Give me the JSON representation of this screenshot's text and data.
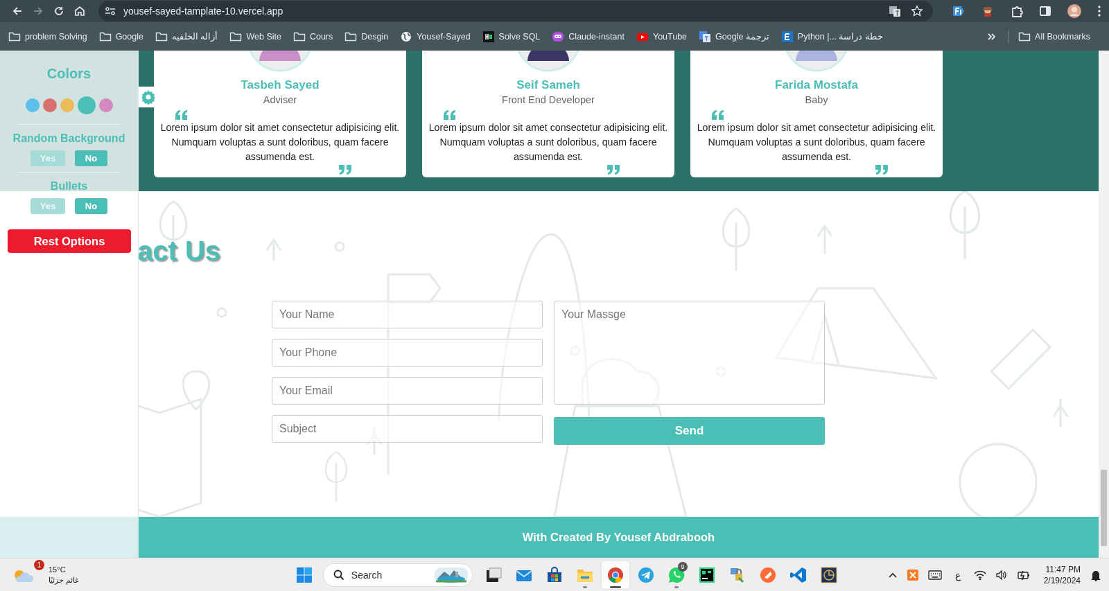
{
  "browser": {
    "nav": [
      {
        "kind": "back",
        "disabled": false
      },
      {
        "kind": "forward",
        "disabled": true
      },
      {
        "kind": "reload",
        "disabled": false
      },
      {
        "kind": "home",
        "disabled": false
      }
    ],
    "url": "yousef-sayed-tamplate-10.vercel.app",
    "bookmarks": [
      {
        "label": "problem Solving",
        "kind": "folder"
      },
      {
        "label": "Google",
        "kind": "folder"
      },
      {
        "label": "أزاله الخلفيه",
        "kind": "folder"
      },
      {
        "label": "Web Site",
        "kind": "folder"
      },
      {
        "label": "Cours",
        "kind": "folder"
      },
      {
        "label": "Desgin",
        "kind": "folder"
      },
      {
        "label": "Yousef-Sayed",
        "kind": "globe"
      },
      {
        "label": "Solve SQL",
        "kind": "code"
      },
      {
        "label": "Claude-instant",
        "kind": "bot"
      },
      {
        "label": "YouTube",
        "kind": "video"
      },
      {
        "label": "Google ترجمة",
        "kind": "translate"
      },
      {
        "label": "Python |... خطة دراسة",
        "kind": "document"
      }
    ],
    "all_bookmarks": "All Bookmarks"
  },
  "settings_panel": {
    "colors_title": "Colors",
    "swatches": [
      {
        "color": "#5bc0eb",
        "selected": false
      },
      {
        "color": "#d9706f",
        "selected": false
      },
      {
        "color": "#ecbb58",
        "selected": false
      },
      {
        "color": "#4bbfb5",
        "selected": true
      },
      {
        "color": "#d289c0",
        "selected": false
      }
    ],
    "groups": [
      {
        "title": "Random Background",
        "options": [
          {
            "label": "Yes",
            "selected": false
          },
          {
            "label": "No",
            "selected": true
          }
        ]
      },
      {
        "title": "Bullets",
        "options": [
          {
            "label": "Yes",
            "selected": false
          },
          {
            "label": "No",
            "selected": true
          }
        ]
      }
    ],
    "reset_button": "Rest Options"
  },
  "testimonials": [
    {
      "name": "Tasbeh Sayed",
      "role": "Adviser",
      "color": "#c98fc9",
      "quote": "Lorem ipsum dolor sit amet consectetur adipisicing elit. Numquam voluptas a sunt doloribus, quam facere assumenda est."
    },
    {
      "name": "Seif Sameh",
      "role": "Front End Developer",
      "color": "#3b3466",
      "quote": "Lorem ipsum dolor sit amet consectetur adipisicing elit. Numquam voluptas a sunt doloribus, quam facere assumenda est."
    },
    {
      "name": "Farida Mostafa",
      "role": "Baby",
      "color": "#aab4e0",
      "quote": "Lorem ipsum dolor sit amet consectetur adipisicing elit. Numquam voluptas a sunt doloribus, quam facere assumenda est."
    }
  ],
  "contact": {
    "heading": "act Us",
    "fields": [
      {
        "placeholder": "Your Name"
      },
      {
        "placeholder": "Your Phone"
      },
      {
        "placeholder": "Your Email"
      },
      {
        "placeholder": "Subject"
      }
    ],
    "message": {
      "placeholder": "Your Massge"
    },
    "send_button": "Send"
  },
  "footer": "With Created By Yousef Abdrabooh",
  "taskbar": {
    "weather": {
      "badge": "1",
      "temperature": "15°C",
      "condition": "غائم جزئيًا"
    },
    "search": {
      "placeholder": "Search"
    },
    "apps": [
      {
        "kind": "task-view",
        "running": false,
        "active": false
      },
      {
        "kind": "mail",
        "running": false,
        "active": false
      },
      {
        "kind": "store",
        "running": false,
        "active": false
      },
      {
        "kind": "folder",
        "running": true,
        "active": false
      },
      {
        "kind": "browser",
        "running": true,
        "active": true
      },
      {
        "kind": "telegram",
        "running": false,
        "active": false
      },
      {
        "kind": "whatsapp",
        "running": true,
        "active": false,
        "badge": "9"
      },
      {
        "kind": "ide",
        "running": false,
        "active": false
      },
      {
        "kind": "lock",
        "running": false,
        "active": false
      },
      {
        "kind": "postman",
        "running": false,
        "active": false
      },
      {
        "kind": "code",
        "running": false,
        "active": false
      },
      {
        "kind": "circle-app",
        "running": false,
        "active": false
      }
    ],
    "language": "ع",
    "time": "11:47 PM",
    "date": "2/19/2024"
  }
}
